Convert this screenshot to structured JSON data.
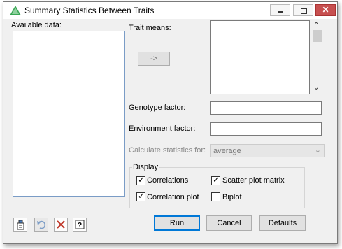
{
  "window": {
    "title": "Summary Statistics Between Traits",
    "close_glyph": "✕"
  },
  "available_data": {
    "label": "Available data:"
  },
  "trait_means": {
    "label": "Trait means:",
    "move_button": "->"
  },
  "genotype_factor": {
    "label": "Genotype factor:",
    "value": ""
  },
  "environment_factor": {
    "label": "Environment factor:",
    "value": ""
  },
  "calculate_statistics": {
    "label": "Calculate statistics for:",
    "value": "average",
    "enabled": false
  },
  "display": {
    "title": "Display",
    "options": [
      {
        "label": "Correlations",
        "checked": true
      },
      {
        "label": "Scatter plot matrix",
        "checked": true
      },
      {
        "label": "Correlation plot",
        "checked": true
      },
      {
        "label": "Biplot",
        "checked": false
      }
    ]
  },
  "buttons": {
    "run": "Run",
    "cancel": "Cancel",
    "defaults": "Defaults"
  },
  "toolbar_icons": [
    "options-icon",
    "undo-icon",
    "clear-icon",
    "help-icon"
  ],
  "colors": {
    "accent": "#0078d7",
    "close": "#c75050",
    "selection_border": "#7a9cc6"
  }
}
